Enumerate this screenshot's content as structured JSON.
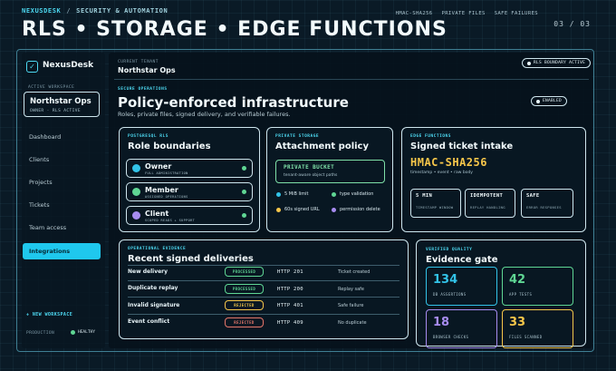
{
  "breadcrumb": {
    "brand": "NEXUSDESK",
    "separator": "/",
    "section": "SECURITY & AUTOMATION"
  },
  "top_meta": [
    "HMAC-SHA256",
    "PRIVATE FILES",
    "SAFE FAILURES"
  ],
  "pager": "03 / 03",
  "hero_title": "RLS • STORAGE • EDGE FUNCTIONS",
  "sidebar": {
    "app_name": "NexusDesk",
    "active_workspace_label": "ACTIVE WORKSPACE",
    "workspace_name": "Northstar Ops",
    "workspace_meta": "OWNER · RLS ACTIVE",
    "nav": [
      "Dashboard",
      "Clients",
      "Projects",
      "Tickets",
      "Team access"
    ],
    "nav_active": "Integrations",
    "new_workspace": "+ NEW WORKSPACE",
    "env_label": "PRODUCTION",
    "env_status": "HEALTHY"
  },
  "tenant": {
    "label": "CURRENT TENANT",
    "name": "Northstar Ops",
    "badge": "RLS BOUNDARY ACTIVE"
  },
  "section": {
    "label": "SECURE OPERATIONS",
    "title": "Policy-enforced infrastructure",
    "subtitle": "Roles, private files, signed delivery, and verifiable failures.",
    "status_badge": "ENABLED"
  },
  "roles_card": {
    "label": "POSTGRESQL RLS",
    "title": "Role boundaries",
    "roles": [
      {
        "name": "Owner",
        "desc": "FULL ADMINISTRATION",
        "color": "#32c3e8"
      },
      {
        "name": "Member",
        "desc": "ASSIGNED OPERATIONS",
        "color": "#5fd694"
      },
      {
        "name": "Client",
        "desc": "SCOPED READS + SUPPORT",
        "color": "#a78cf0"
      }
    ]
  },
  "storage_card": {
    "label": "PRIVATE STORAGE",
    "title": "Attachment policy",
    "bucket_title": "PRIVATE BUCKET",
    "bucket_sub": "tenant-aware object paths",
    "features": [
      {
        "text": "5 MiB limit",
        "color": "#32c3e8"
      },
      {
        "text": "type validation",
        "color": "#5fd694"
      },
      {
        "text": "60s signed URL",
        "color": "#f6c64a"
      },
      {
        "text": "permission delete",
        "color": "#a78cf0"
      }
    ]
  },
  "edge_card": {
    "label": "EDGE FUNCTIONS",
    "title": "Signed ticket intake",
    "algo": "HMAC-SHA256",
    "algo_sub": "timestamp • event • raw body",
    "tiles": [
      {
        "title": "5 MIN",
        "sub": "TIMESTAMP WINDOW"
      },
      {
        "title": "IDEMPOTENT",
        "sub": "REPLAY HANDLING"
      },
      {
        "title": "SAFE",
        "sub": "ERROR RESPONSES"
      }
    ]
  },
  "deliveries": {
    "label": "OPERATIONAL EVIDENCE",
    "title": "Recent signed deliveries",
    "rows": [
      {
        "event": "New delivery",
        "status": "PROCESSED",
        "code": "HTTP 201",
        "note": "Ticket created",
        "color": "#5fd694"
      },
      {
        "event": "Duplicate replay",
        "status": "PROCESSED",
        "code": "HTTP 200",
        "note": "Replay safe",
        "color": "#5fd694"
      },
      {
        "event": "Invalid signature",
        "status": "REJECTED",
        "code": "HTTP 401",
        "note": "Safe failure",
        "color": "#f6c64a"
      },
      {
        "event": "Event conflict",
        "status": "REJECTED",
        "code": "HTTP 409",
        "note": "No duplicate",
        "color": "#e8766a"
      }
    ]
  },
  "evidence": {
    "label": "VERIFIED QUALITY",
    "title": "Evidence gate",
    "metrics": [
      {
        "value": "134",
        "label": "DB ASSERTIONS",
        "color": "#32c3e8"
      },
      {
        "value": "42",
        "label": "APP TESTS",
        "color": "#5fd694"
      },
      {
        "value": "18",
        "label": "BROWSER CHECKS",
        "color": "#a78cf0"
      },
      {
        "value": "33",
        "label": "FILES SCANNED",
        "color": "#f6c64a"
      }
    ]
  },
  "colors": {
    "accent": "#4dd9f2",
    "success": "#5fd694",
    "warning": "#f6c64a",
    "danger": "#e8766a",
    "violet": "#a78cf0"
  }
}
